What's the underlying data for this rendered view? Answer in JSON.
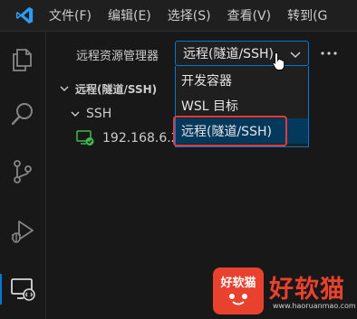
{
  "titlebar": {
    "logo_icon": "vscode-logo-icon",
    "menu": [
      "文件(F)",
      "编辑(E)",
      "选择(S)",
      "查看(V)",
      "转到(G"
    ]
  },
  "activitybar": {
    "items": [
      {
        "icon": "explorer-icon"
      },
      {
        "icon": "search-icon"
      },
      {
        "icon": "source-control-icon"
      },
      {
        "icon": "run-debug-icon"
      },
      {
        "icon": "remote-explorer-icon",
        "active": true
      }
    ]
  },
  "sidebar": {
    "title": "远程资源管理器",
    "select_value": "远程(隧道/SSH)",
    "more_icon": "ellipsis-icon",
    "dropdown_options": [
      "开发容器",
      "WSL 目标",
      "远程(隧道/SSH)"
    ],
    "tree": {
      "section": "远程(隧道/SSH)",
      "group": "SSH",
      "host": "192.168.6.2"
    }
  },
  "watermark": {
    "badge": "好软猫",
    "text": "好软猫",
    "url": "www.haoruanmao.com"
  },
  "colors": {
    "accent": "#0078d4",
    "highlight": "#e03b3b",
    "connected": "#3fb950",
    "watermark": "#e8412e"
  }
}
